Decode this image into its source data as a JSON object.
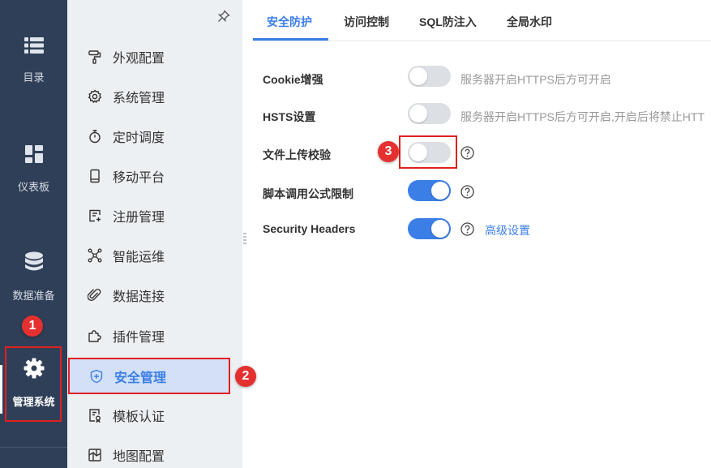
{
  "rail": {
    "items": [
      {
        "label": "目录",
        "icon": "list-icon"
      },
      {
        "label": "仪表板",
        "icon": "dashboard-icon"
      },
      {
        "label": "数据准备",
        "icon": "database-icon"
      },
      {
        "label": "管理系统",
        "icon": "gear-icon"
      }
    ]
  },
  "sidebar": {
    "items": [
      {
        "label": "外观配置",
        "icon": "paint-roller-icon"
      },
      {
        "label": "系统管理",
        "icon": "settings-icon"
      },
      {
        "label": "定时调度",
        "icon": "timer-icon"
      },
      {
        "label": "移动平台",
        "icon": "mobile-icon"
      },
      {
        "label": "注册管理",
        "icon": "register-icon"
      },
      {
        "label": "智能运维",
        "icon": "network-icon"
      },
      {
        "label": "数据连接",
        "icon": "paperclip-icon"
      },
      {
        "label": "插件管理",
        "icon": "puzzle-icon"
      },
      {
        "label": "安全管理",
        "icon": "shield-icon"
      },
      {
        "label": "模板认证",
        "icon": "document-icon"
      },
      {
        "label": "地图配置",
        "icon": "map-icon"
      }
    ],
    "active_index": 8
  },
  "tabs": [
    {
      "label": "安全防护"
    },
    {
      "label": "访问控制"
    },
    {
      "label": "SQL防注入"
    },
    {
      "label": "全局水印"
    }
  ],
  "settings": [
    {
      "label": "Cookie增强",
      "enabled": false,
      "hint": "服务器开启HTTPS后方可开启"
    },
    {
      "label": "HSTS设置",
      "enabled": false,
      "hint": "服务器开启HTTPS后方可开启,开启后将禁止HTT"
    },
    {
      "label": "文件上传校验",
      "enabled": false
    },
    {
      "label": "脚本调用公式限制",
      "enabled": true
    },
    {
      "label": "Security Headers",
      "enabled": true,
      "link": "高级设置"
    }
  ],
  "annotations": {
    "badge1": "1",
    "badge2": "2",
    "badge3": "3"
  },
  "colors": {
    "accent": "#3a7ee6",
    "rail_bg": "#2f3f57",
    "sidebar_bg": "#edf0f3",
    "annotation": "#e02020"
  }
}
